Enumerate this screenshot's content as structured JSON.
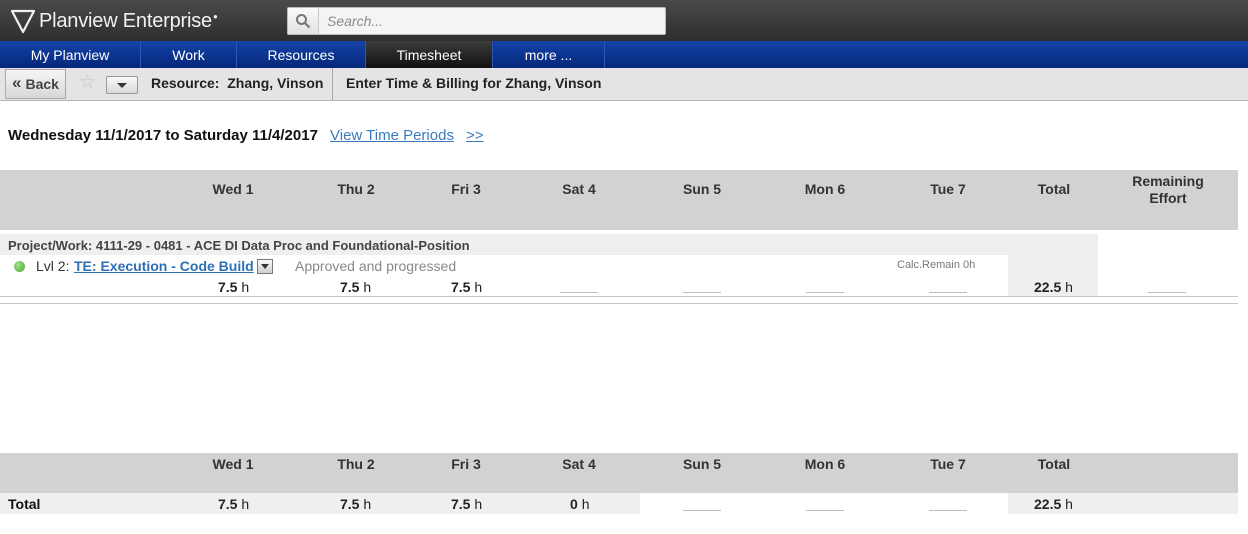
{
  "header": {
    "app_name": "Planview Enterprise",
    "search_placeholder": "Search..."
  },
  "nav": {
    "items": [
      {
        "label": "My Planview"
      },
      {
        "label": "Work"
      },
      {
        "label": "Resources"
      },
      {
        "label": "Timesheet",
        "active": true
      },
      {
        "label": "more ..."
      }
    ]
  },
  "toolbar": {
    "back_label": "Back",
    "back_icon": "double-chevron-left-icon",
    "favorite_icon": "star-icon",
    "resource_label": "Resource:  Zhang, Vinson",
    "page_title": "Enter Time & Billing for Zhang, Vinson"
  },
  "period": {
    "range": "Wednesday 11/1/2017 to Saturday 11/4/2017",
    "view_link": "View Time Periods",
    "next_link": ">>"
  },
  "columns": {
    "days": [
      "Wed 1",
      "Thu 2",
      "Fri 3",
      "Sat 4",
      "Sun 5",
      "Mon 6",
      "Tue 7"
    ],
    "total": "Total",
    "remaining_line1": "Remaining",
    "remaining_line2": "Effort"
  },
  "project": {
    "title": "Project/Work: 4111-29 - 0481 - ACE DI Data Proc and Foundational-Position",
    "level": "Lvl 2:",
    "task_name": "TE: Execution - Code Build",
    "status": "Approved and progressed",
    "calc_remain": "Calc.Remain 0h",
    "status_color": "#5cb544",
    "hours": {
      "wed": "7.5",
      "thu": "7.5",
      "fri": "7.5",
      "total": "22.5",
      "unit": "h"
    }
  },
  "totals": {
    "label": "Total",
    "wed": "7.5",
    "thu": "7.5",
    "fri": "7.5",
    "sat": "0",
    "total": "22.5",
    "unit": "h"
  },
  "colors": {
    "nav_bg": "#0a3596",
    "link": "#3a7bc0",
    "header_bar": "#d2d2d2"
  }
}
